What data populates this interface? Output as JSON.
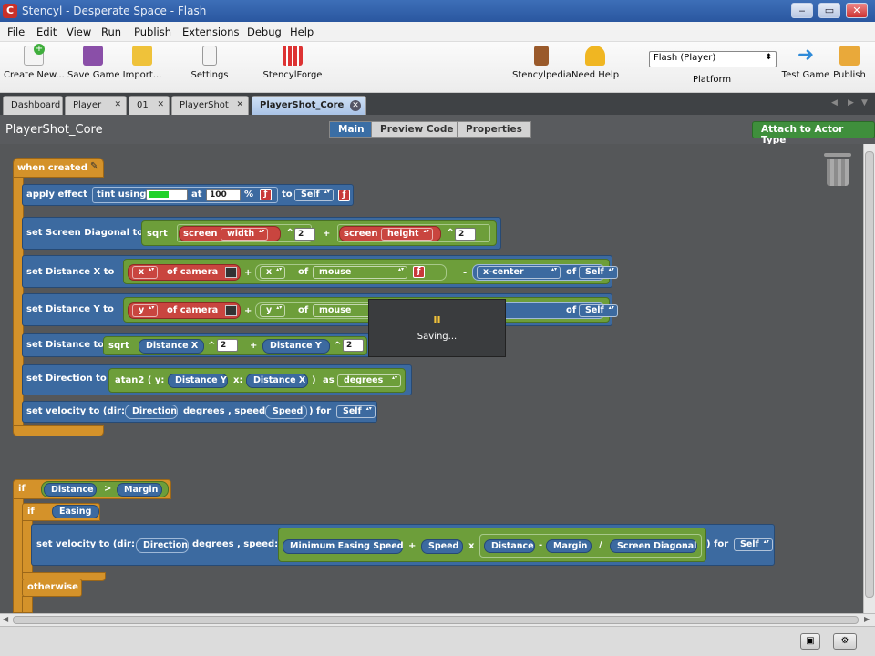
{
  "window": {
    "app_icon": "C",
    "title": "Stencyl - Desperate Space - Flash",
    "minimize": "‒",
    "maximize": "▭",
    "close": "✕"
  },
  "menu": [
    "File",
    "Edit",
    "View",
    "Run",
    "Publish",
    "Extensions",
    "Debug",
    "Help"
  ],
  "toolbar": {
    "create": "Create New...",
    "save": "Save Game",
    "import": "Import...",
    "settings": "Settings",
    "forge": "StencylForge",
    "pedia": "Stencylpedia",
    "help": "Need Help",
    "platform_value": "Flash (Player)",
    "platform_label": "Platform",
    "test": "Test Game",
    "publish": "Publish"
  },
  "tabs": [
    {
      "label": "Dashboard"
    },
    {
      "label": "Player"
    },
    {
      "label": "01"
    },
    {
      "label": "PlayerShot"
    },
    {
      "label": "PlayerShot_Core"
    }
  ],
  "header": {
    "name": "PlayerShot_Core",
    "seg_main": "Main",
    "seg_preview": "Preview Code",
    "seg_props": "Properties",
    "attach": "Attach to Actor Type"
  },
  "blocks": {
    "when_created": "when created",
    "apply_effect": "apply effect",
    "tint_using": "tint using",
    "at": "at",
    "tint_value": "100",
    "percent": "%",
    "to": "to",
    "self": "Self",
    "set_diag": "set Screen Diagonal to",
    "sqrt": "sqrt",
    "screen": "screen",
    "width": "width",
    "height": "height",
    "pow": "^",
    "two": "2",
    "plus": "+",
    "set_dx": "set Distance X to",
    "set_dy": "set Distance Y to",
    "x": "x",
    "y": "y",
    "of_camera": "of camera",
    "of": "of",
    "mouse": "mouse",
    "minus": "-",
    "x_center": "x-center",
    "set_dist": "set Distance to",
    "distance_x": "Distance X",
    "distance_y": "Distance Y",
    "set_dir": "set Direction to",
    "atan2": "atan2 ( y:",
    "x_colon": "x:",
    "close_paren": ")",
    "as": "as",
    "degrees": "degrees",
    "set_vel": "set velocity to (dir:",
    "direction": "Direction",
    "degrees_speed": "degrees , speed:",
    "speed": "Speed",
    "for": ") for",
    "if": "if",
    "distance": "Distance",
    "gt": ">",
    "margin": "Margin",
    "easing": "Easing",
    "min_easing": "Minimum Easing Speed",
    "times": "x",
    "divide": "/",
    "screen_diagonal": "Screen Diagonal",
    "otherwise": "otherwise"
  },
  "saving": {
    "icon": "II",
    "text": "Saving..."
  }
}
